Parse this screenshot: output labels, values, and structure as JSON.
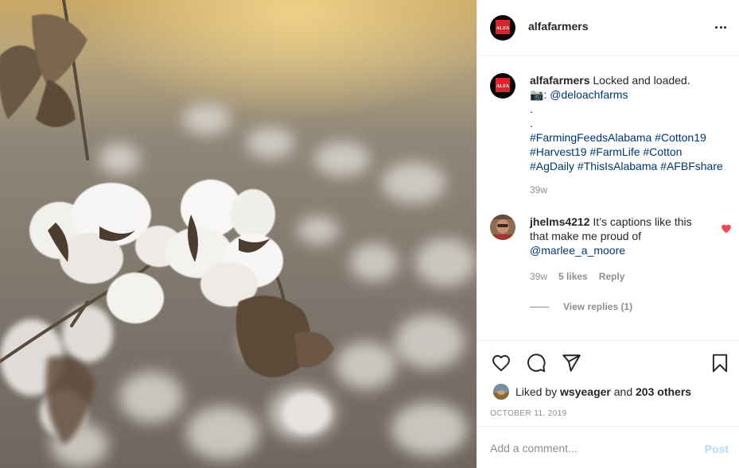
{
  "post": {
    "username": "alfafarmers",
    "avatar_logo_text": "ALFA",
    "image_alt": "Cotton bolls in a field"
  },
  "caption": {
    "username": "alfafarmers",
    "text": "Locked and loaded.",
    "camera_emoji": "📷",
    "credit_handle": "@deloachfarms",
    "dot1": ".",
    "dot2": ".",
    "hashtags_line1": "#FarmingFeedsAlabama #Cotton19",
    "hashtags_line2": "#Harvest19 #FarmLife #Cotton",
    "hashtags_line3": "#AgDaily #ThisIsAlabama #AFBFshare",
    "time": "39w"
  },
  "comment": {
    "username": "jhelms4212",
    "text_part1": "It’s captions like this that make me proud of",
    "mention": "@marlee_a_moore",
    "time": "39w",
    "likes": "5 likes",
    "reply_label": "Reply",
    "view_replies": "View replies (1)"
  },
  "actions": {
    "liked_prefix": "Liked by",
    "liked_user": "wsyeager",
    "liked_and": "and",
    "liked_others": "203 others",
    "date": "OCTOBER 11, 2019"
  },
  "add_comment": {
    "placeholder": "Add a comment...",
    "post_label": "Post"
  },
  "icons": {
    "more": "more-options-icon",
    "like": "heart-icon",
    "comment": "comment-icon",
    "share": "share-icon",
    "save": "bookmark-icon",
    "comment_like": "heart-filled-icon"
  },
  "colors": {
    "link": "#00376b",
    "muted": "#8e8e8e",
    "heart": "#ed4956",
    "post_disabled": "#b3dbff",
    "logo_red": "#d6262c"
  }
}
